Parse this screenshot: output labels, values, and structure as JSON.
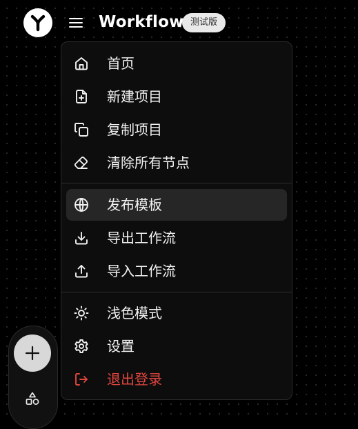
{
  "app": {
    "title": "Workflow",
    "badge": "测试版"
  },
  "menu": {
    "items": [
      {
        "label": "首页",
        "icon": "home-icon"
      },
      {
        "label": "新建项目",
        "icon": "file-plus-icon"
      },
      {
        "label": "复制项目",
        "icon": "copy-icon"
      },
      {
        "label": "清除所有节点",
        "icon": "eraser-icon"
      },
      {
        "label": "发布模板",
        "icon": "globe-icon",
        "active": true
      },
      {
        "label": "导出工作流",
        "icon": "download-icon"
      },
      {
        "label": "导入工作流",
        "icon": "upload-icon"
      },
      {
        "label": "浅色模式",
        "icon": "sun-icon"
      },
      {
        "label": "设置",
        "icon": "gear-icon"
      },
      {
        "label": "退出登录",
        "icon": "logout-icon",
        "danger": true
      }
    ]
  },
  "dock": {
    "buttons": [
      {
        "icon": "plus-icon"
      },
      {
        "icon": "shapes-icon"
      }
    ]
  },
  "colors": {
    "background": "#000000",
    "menu_background": "#0d0d0d",
    "active_item": "#262626",
    "danger": "#e0463f",
    "text": "#f2f2f2"
  }
}
